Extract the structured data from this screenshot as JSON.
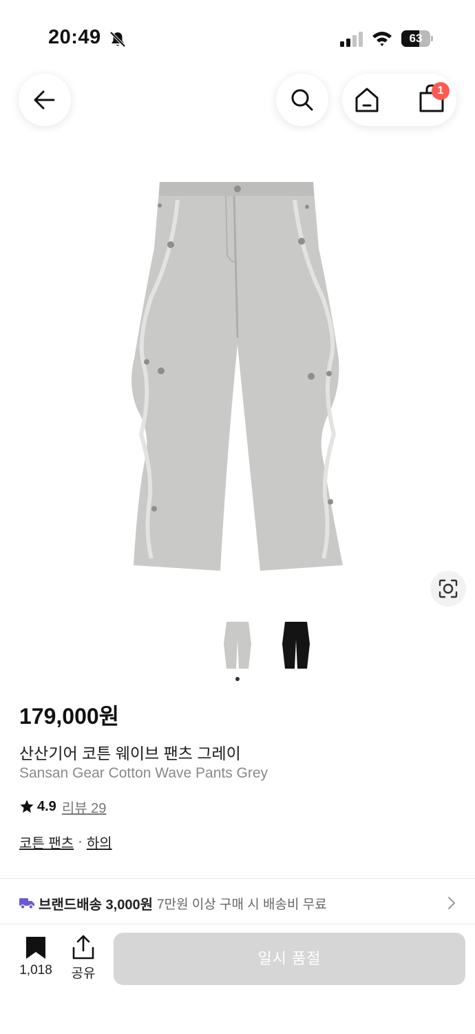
{
  "status_bar": {
    "time": "20:49",
    "battery": "63",
    "battery_level": 0.63
  },
  "header": {
    "cart_badge": "1"
  },
  "product": {
    "price": "179,000원",
    "name_ko": "산산기어 코튼 웨이브 팬츠 그레이",
    "name_en": "Sansan Gear Cotton Wave Pants Grey",
    "rating": "4.9",
    "review_link": "리뷰 29",
    "categories": [
      "코튼 팬츠",
      "하의"
    ],
    "category_separator": "·"
  },
  "shipping": {
    "label": "브랜드배송 3,000원",
    "note": "7만원 이상 구매 시 배송비 무료"
  },
  "bottom_bar": {
    "save_count": "1,018",
    "share_label": "공유",
    "cta_label": "일시 품절"
  },
  "colors": {
    "accent_badge": "#ff5a52",
    "truck": "#6b5bd6",
    "soldout_bg": "#d6d6d6"
  }
}
